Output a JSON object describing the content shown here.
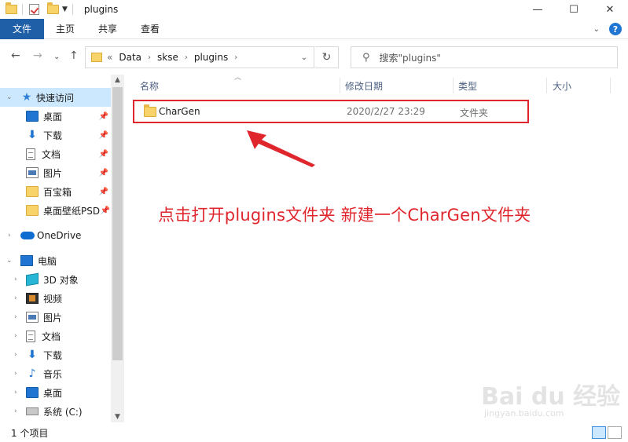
{
  "window": {
    "title": "plugins",
    "minimize": "—",
    "maximize": "☐",
    "close": "✕"
  },
  "ribbon": {
    "tabs": [
      "文件",
      "主页",
      "共享",
      "查看"
    ],
    "help": "?",
    "collapse": "⌄"
  },
  "nav_buttons": {
    "back": "←",
    "forward": "→",
    "recent": "⌄",
    "up": "↑"
  },
  "address": {
    "overflow": "«",
    "parts": [
      "Data",
      "skse",
      "plugins"
    ],
    "separator": "›",
    "dropdown": "⌄",
    "refresh": "↻"
  },
  "search": {
    "placeholder": "搜索\"plugins\""
  },
  "sidebar": {
    "quick_access": "快速访问",
    "items": [
      {
        "label": "桌面",
        "icon": "desktop-icon",
        "pinned": true
      },
      {
        "label": "下载",
        "icon": "download-arrow-icon",
        "pinned": true
      },
      {
        "label": "文档",
        "icon": "document-icon",
        "pinned": true
      },
      {
        "label": "图片",
        "icon": "pictures-icon",
        "pinned": true
      },
      {
        "label": "百宝箱",
        "icon": "folder-icon",
        "pinned": true
      },
      {
        "label": "桌面壁纸PSD",
        "icon": "folder-icon",
        "pinned": true
      }
    ],
    "onedrive": "OneDrive",
    "this_pc": "电脑",
    "pc_items": [
      {
        "label": "3D 对象",
        "icon": "3d-objects-icon"
      },
      {
        "label": "视频",
        "icon": "videos-icon"
      },
      {
        "label": "图片",
        "icon": "pictures-icon"
      },
      {
        "label": "文档",
        "icon": "document-icon"
      },
      {
        "label": "下载",
        "icon": "download-arrow-icon"
      },
      {
        "label": "音乐",
        "icon": "music-icon"
      },
      {
        "label": "桌面",
        "icon": "desktop-icon"
      },
      {
        "label": "系统 (C:)",
        "icon": "drive-icon"
      }
    ]
  },
  "columns": {
    "name": "名称",
    "modified": "修改日期",
    "type": "类型",
    "size": "大小"
  },
  "files": [
    {
      "name": "CharGen",
      "modified": "2020/2/27 23:29",
      "type": "文件夹"
    }
  ],
  "annotation": {
    "text": "点击打开plugins文件夹 新建一个CharGen文件夹",
    "color": "#e0262d"
  },
  "status": {
    "count": "1 个项目"
  },
  "watermark": {
    "logo": "Bai du 经验",
    "url": "jingyan.baidu.com"
  },
  "colors": {
    "accent": "#1f5fa8",
    "selection": "#cce8ff",
    "annotation": "#e0262d"
  }
}
